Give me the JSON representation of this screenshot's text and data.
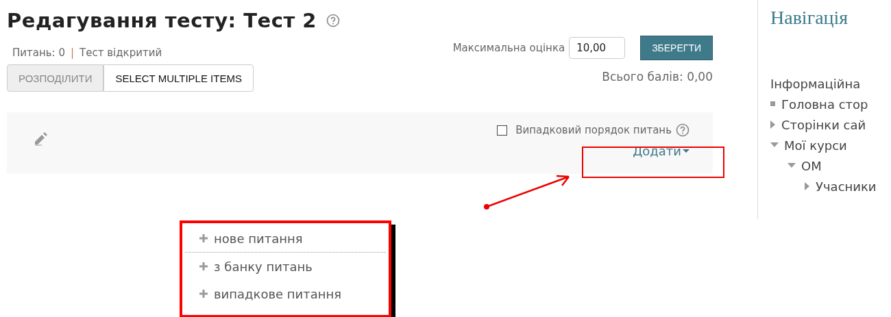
{
  "title": "Редагування тесту: Тест 2",
  "summary": {
    "questions": "Питань: 0",
    "separator": "|",
    "status": "Тест відкритий"
  },
  "max_grade": {
    "label": "Максимальна оцінка",
    "value": "10,00",
    "save_button": "ЗБЕРЕГТИ"
  },
  "buttons": [
    {
      "label": "РОЗПОДІЛИТИ",
      "disabled": true
    },
    {
      "label": "SELECT MULTIPLE ITEMS",
      "disabled": false
    }
  ],
  "total": "Всього балів: 0,00",
  "section": {
    "shuffle": {
      "label": "Випадковий порядок питань",
      "checked": false
    },
    "add": "Додати"
  },
  "add_menu": [
    {
      "label": "нове питання"
    },
    {
      "label": "з банку питань"
    },
    {
      "label": "випадкове питання"
    }
  ],
  "navigation": {
    "title": "Навігація",
    "heading": "Інформаційна",
    "items": [
      {
        "label": "Головна стор",
        "kind": "leaf"
      },
      {
        "label": "Сторінки сай",
        "kind": "branch",
        "expanded": false
      },
      {
        "label": "Мої курси",
        "kind": "branch",
        "expanded": true,
        "children": [
          {
            "label": "ОМ",
            "kind": "branch",
            "expanded": true,
            "children": [
              {
                "label": "Учасники",
                "kind": "branch",
                "expanded": false
              }
            ]
          }
        ]
      }
    ]
  }
}
